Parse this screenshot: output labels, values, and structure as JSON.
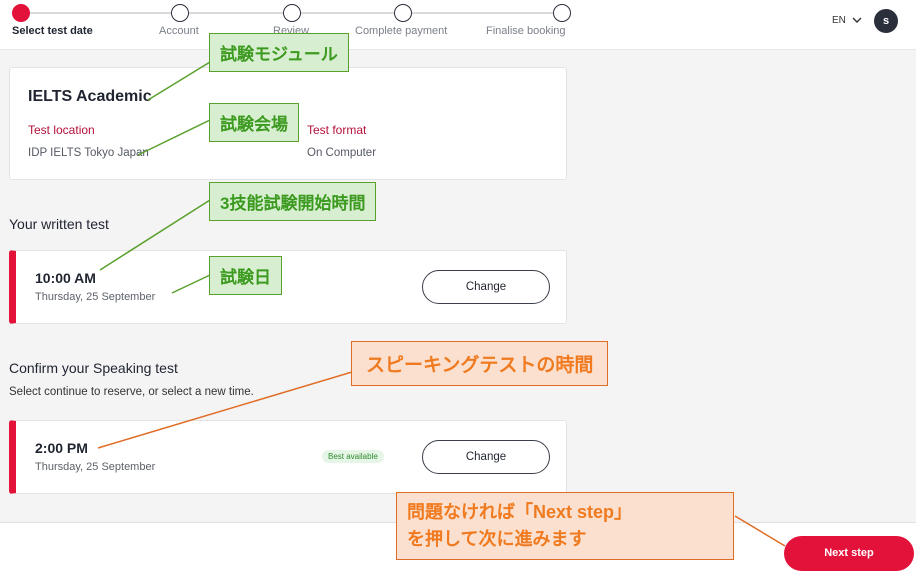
{
  "stepper": {
    "steps": [
      {
        "label": "Select test date",
        "active": true
      },
      {
        "label": "Account",
        "active": false
      },
      {
        "label": "Review",
        "active": false
      },
      {
        "label": "Complete payment",
        "active": false
      },
      {
        "label": "Finalise booking",
        "active": false
      }
    ]
  },
  "header": {
    "language": "EN",
    "avatar_initial": "s"
  },
  "test_card": {
    "title": "IELTS Academic",
    "location_label": "Test location",
    "location_value": "IDP IELTS Tokyo Japan",
    "format_label": "Test format",
    "format_value": "On Computer"
  },
  "written": {
    "section_title": "Your written test",
    "time": "10:00 AM",
    "date": "Thursday, 25 September",
    "change_label": "Change"
  },
  "speaking": {
    "section_title": "Confirm your Speaking test",
    "subtitle": "Select continue to reserve, or select a new time.",
    "time": "2:00 PM",
    "date": "Thursday, 25 September",
    "badge": "Best available",
    "change_label": "Change"
  },
  "footer": {
    "next_label": "Next step"
  },
  "annotations": {
    "module": "試験モジュール",
    "venue": "試験会場",
    "written_time": "3技能試験開始時間",
    "test_day": "試験日",
    "speaking_time": "スピーキングテストの時間",
    "next_line1": "問題なければ「Next step」",
    "next_line2": "を押して次に進みます"
  },
  "colors": {
    "accent": "#e2123a",
    "green_callout": "#5aa02c",
    "orange_callout": "#e06d25"
  }
}
